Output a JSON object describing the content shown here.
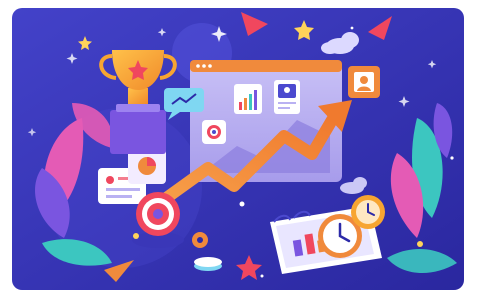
{
  "image": {
    "description_free": true,
    "palette": {
      "background_top": "#3F3FC4",
      "background_bottom": "#2C2AA8",
      "window": "#B9B1F2",
      "window_bar": "#F08A3C",
      "arrow": "#F08A3C",
      "trophy": "#F7A531",
      "clock_face": "#FFFFFF",
      "leaf_pink": "#E45BB5",
      "leaf_teal": "#3CC6C0",
      "leaf_purple": "#7A55E0",
      "accent_red": "#F0475E",
      "accent_yellow": "#FFD35A"
    }
  }
}
